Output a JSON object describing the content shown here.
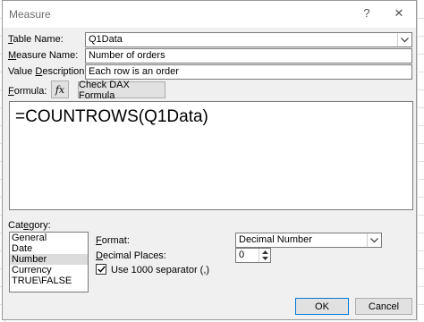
{
  "dialog": {
    "title": "Measure",
    "help_glyph": "?",
    "close_glyph": "✕"
  },
  "form": {
    "table_name_label_u": "T",
    "table_name_label_rest": "able Name:",
    "table_name_value": "Q1Data",
    "measure_name_label_u": "M",
    "measure_name_label_rest": "easure Name:",
    "measure_name_value": "Number of orders",
    "value_description_label_a": "Value ",
    "value_description_label_u": "D",
    "value_description_label_rest": "escription:",
    "value_description_value": "Each row is an order",
    "formula_label_u": "F",
    "formula_label_rest": "ormula:",
    "fx_glyph": "fx",
    "check_dax_label_u": "H",
    "check_dax_label_rest": "Check DAX Formula",
    "formula_text": "=COUNTROWS(Q1Data)"
  },
  "category": {
    "label_a": "Cat",
    "label_u": "e",
    "label_rest": "gory:",
    "items": [
      "General",
      "Date",
      "Number",
      "Currency",
      "TRUE\\FALSE"
    ],
    "selected": "Number"
  },
  "format": {
    "format_label_u": "F",
    "format_label_rest": "ormat:",
    "format_value": "Decimal Number",
    "decimal_places_label_u": "D",
    "decimal_places_label_rest": "ecimal Places:",
    "decimal_places_value": "0",
    "separator_label": "Use 1000 separator (,)",
    "separator_checked": true
  },
  "buttons": {
    "ok": "OK",
    "cancel": "Cancel"
  }
}
